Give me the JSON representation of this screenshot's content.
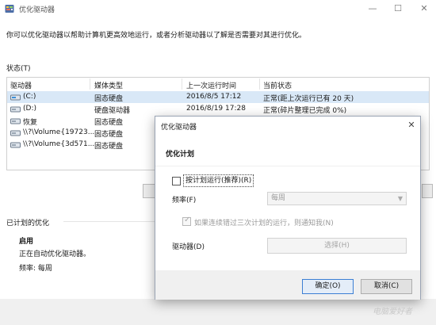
{
  "window": {
    "title": "优化驱动器",
    "intro": "你可以优化驱动器以帮助计算机更高效地运行，或者分析驱动器以了解是否需要对其进行优化。",
    "status_label": "状态(T)"
  },
  "drive_list": {
    "columns": [
      "驱动器",
      "媒体类型",
      "上一次运行时间",
      "当前状态"
    ],
    "rows": [
      {
        "drive": "(C:)",
        "media": "固态硬盘",
        "last_run": "2016/8/5 17:12",
        "status": "正常(距上次运行已有 20 天)"
      },
      {
        "drive": "(D:)",
        "media": "硬盘驱动器",
        "last_run": "2016/8/19 17:28",
        "status": "正常(碎片整理已完成 0%)"
      },
      {
        "drive": "恢复",
        "media": "固态硬盘",
        "last_run": "",
        "status": ""
      },
      {
        "drive": "\\\\?\\Volume{19723...",
        "media": "固态硬盘",
        "last_run": "",
        "status": ""
      },
      {
        "drive": "\\\\?\\Volume{3d571...",
        "media": "固态硬盘",
        "last_run": "",
        "status": ""
      }
    ]
  },
  "scheduled": {
    "label": "已计划的优化",
    "status": "启用",
    "detail": "正在自动优化驱动器。",
    "frequency": "频率: 每周"
  },
  "dialog": {
    "title": "优化驱动器",
    "section": "优化计划",
    "schedule_checkbox": "按计划运行(推荐)(R)",
    "frequency_label": "频率(F)",
    "frequency_value": "每周",
    "notify_label": "如果连续错过三次计划的运行，则通知我(N)",
    "drives_label": "驱动器(D)",
    "choose_button": "选择(H)",
    "ok_button": "确定(O)",
    "cancel_button": "取消(C)"
  },
  "watermark": "电脑爱好者",
  "colors": {
    "selected_row": "#d9e8f7",
    "accent_border": "#3c7fd4",
    "dialog_footer": "#f0f0f0"
  },
  "icons": {
    "app": "defrag-app-icon",
    "drive": "hard-drive-icon"
  }
}
